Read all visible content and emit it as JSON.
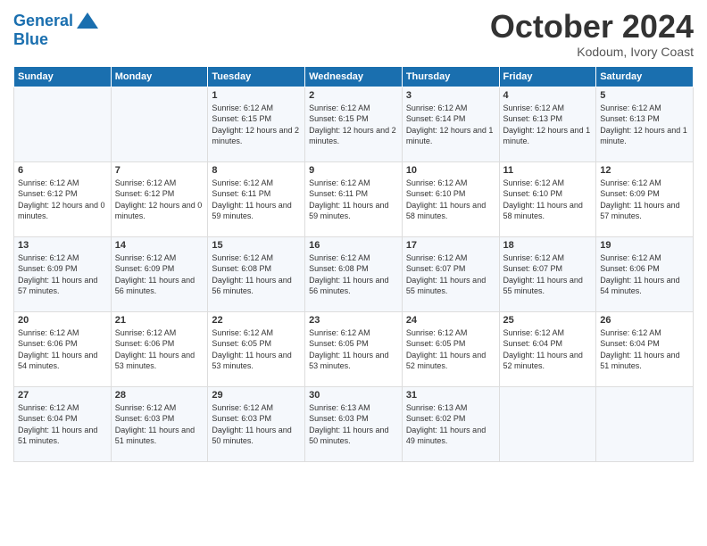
{
  "logo": {
    "line1": "General",
    "line2": "Blue"
  },
  "title": "October 2024",
  "subtitle": "Kodoum, Ivory Coast",
  "days_header": [
    "Sunday",
    "Monday",
    "Tuesday",
    "Wednesday",
    "Thursday",
    "Friday",
    "Saturday"
  ],
  "weeks": [
    [
      {
        "day": "",
        "info": ""
      },
      {
        "day": "",
        "info": ""
      },
      {
        "day": "1",
        "info": "Sunrise: 6:12 AM\nSunset: 6:15 PM\nDaylight: 12 hours and 2 minutes."
      },
      {
        "day": "2",
        "info": "Sunrise: 6:12 AM\nSunset: 6:15 PM\nDaylight: 12 hours and 2 minutes."
      },
      {
        "day": "3",
        "info": "Sunrise: 6:12 AM\nSunset: 6:14 PM\nDaylight: 12 hours and 1 minute."
      },
      {
        "day": "4",
        "info": "Sunrise: 6:12 AM\nSunset: 6:13 PM\nDaylight: 12 hours and 1 minute."
      },
      {
        "day": "5",
        "info": "Sunrise: 6:12 AM\nSunset: 6:13 PM\nDaylight: 12 hours and 1 minute."
      }
    ],
    [
      {
        "day": "6",
        "info": "Sunrise: 6:12 AM\nSunset: 6:12 PM\nDaylight: 12 hours and 0 minutes."
      },
      {
        "day": "7",
        "info": "Sunrise: 6:12 AM\nSunset: 6:12 PM\nDaylight: 12 hours and 0 minutes."
      },
      {
        "day": "8",
        "info": "Sunrise: 6:12 AM\nSunset: 6:11 PM\nDaylight: 11 hours and 59 minutes."
      },
      {
        "day": "9",
        "info": "Sunrise: 6:12 AM\nSunset: 6:11 PM\nDaylight: 11 hours and 59 minutes."
      },
      {
        "day": "10",
        "info": "Sunrise: 6:12 AM\nSunset: 6:10 PM\nDaylight: 11 hours and 58 minutes."
      },
      {
        "day": "11",
        "info": "Sunrise: 6:12 AM\nSunset: 6:10 PM\nDaylight: 11 hours and 58 minutes."
      },
      {
        "day": "12",
        "info": "Sunrise: 6:12 AM\nSunset: 6:09 PM\nDaylight: 11 hours and 57 minutes."
      }
    ],
    [
      {
        "day": "13",
        "info": "Sunrise: 6:12 AM\nSunset: 6:09 PM\nDaylight: 11 hours and 57 minutes."
      },
      {
        "day": "14",
        "info": "Sunrise: 6:12 AM\nSunset: 6:09 PM\nDaylight: 11 hours and 56 minutes."
      },
      {
        "day": "15",
        "info": "Sunrise: 6:12 AM\nSunset: 6:08 PM\nDaylight: 11 hours and 56 minutes."
      },
      {
        "day": "16",
        "info": "Sunrise: 6:12 AM\nSunset: 6:08 PM\nDaylight: 11 hours and 56 minutes."
      },
      {
        "day": "17",
        "info": "Sunrise: 6:12 AM\nSunset: 6:07 PM\nDaylight: 11 hours and 55 minutes."
      },
      {
        "day": "18",
        "info": "Sunrise: 6:12 AM\nSunset: 6:07 PM\nDaylight: 11 hours and 55 minutes."
      },
      {
        "day": "19",
        "info": "Sunrise: 6:12 AM\nSunset: 6:06 PM\nDaylight: 11 hours and 54 minutes."
      }
    ],
    [
      {
        "day": "20",
        "info": "Sunrise: 6:12 AM\nSunset: 6:06 PM\nDaylight: 11 hours and 54 minutes."
      },
      {
        "day": "21",
        "info": "Sunrise: 6:12 AM\nSunset: 6:06 PM\nDaylight: 11 hours and 53 minutes."
      },
      {
        "day": "22",
        "info": "Sunrise: 6:12 AM\nSunset: 6:05 PM\nDaylight: 11 hours and 53 minutes."
      },
      {
        "day": "23",
        "info": "Sunrise: 6:12 AM\nSunset: 6:05 PM\nDaylight: 11 hours and 53 minutes."
      },
      {
        "day": "24",
        "info": "Sunrise: 6:12 AM\nSunset: 6:05 PM\nDaylight: 11 hours and 52 minutes."
      },
      {
        "day": "25",
        "info": "Sunrise: 6:12 AM\nSunset: 6:04 PM\nDaylight: 11 hours and 52 minutes."
      },
      {
        "day": "26",
        "info": "Sunrise: 6:12 AM\nSunset: 6:04 PM\nDaylight: 11 hours and 51 minutes."
      }
    ],
    [
      {
        "day": "27",
        "info": "Sunrise: 6:12 AM\nSunset: 6:04 PM\nDaylight: 11 hours and 51 minutes."
      },
      {
        "day": "28",
        "info": "Sunrise: 6:12 AM\nSunset: 6:03 PM\nDaylight: 11 hours and 51 minutes."
      },
      {
        "day": "29",
        "info": "Sunrise: 6:12 AM\nSunset: 6:03 PM\nDaylight: 11 hours and 50 minutes."
      },
      {
        "day": "30",
        "info": "Sunrise: 6:13 AM\nSunset: 6:03 PM\nDaylight: 11 hours and 50 minutes."
      },
      {
        "day": "31",
        "info": "Sunrise: 6:13 AM\nSunset: 6:02 PM\nDaylight: 11 hours and 49 minutes."
      },
      {
        "day": "",
        "info": ""
      },
      {
        "day": "",
        "info": ""
      }
    ]
  ]
}
